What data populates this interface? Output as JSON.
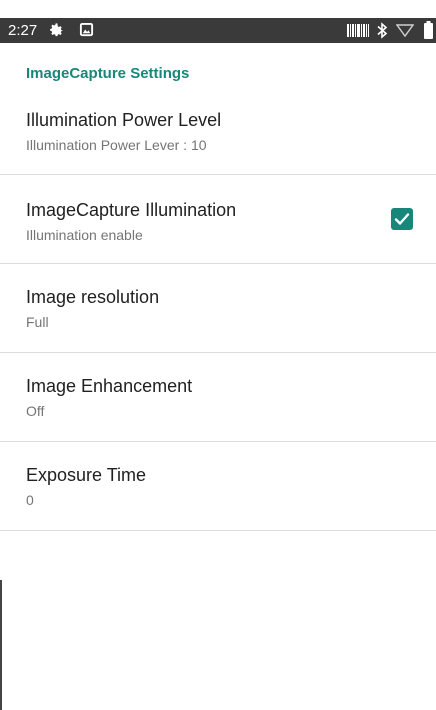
{
  "status_bar": {
    "time": "2:27",
    "icons": [
      "settings-gear-icon",
      "image-notification-icon",
      "barcode-icon",
      "bluetooth-icon",
      "wifi-icon",
      "battery-icon"
    ]
  },
  "section": {
    "header": "ImageCapture Settings"
  },
  "preferences": [
    {
      "title": "Illumination Power Level",
      "summary": "Illumination Power Lever : 10"
    },
    {
      "title": "ImageCapture Illumination",
      "summary": "Illumination enable",
      "checked": true
    },
    {
      "title": "Image resolution",
      "summary": "Full"
    },
    {
      "title": "Image Enhancement",
      "summary": "Off"
    },
    {
      "title": "Exposure Time",
      "summary": "0"
    }
  ],
  "colors": {
    "accent": "#18877a",
    "status_bar": "#3a3a3a",
    "title_text": "#212121",
    "summary_text": "#757575"
  }
}
